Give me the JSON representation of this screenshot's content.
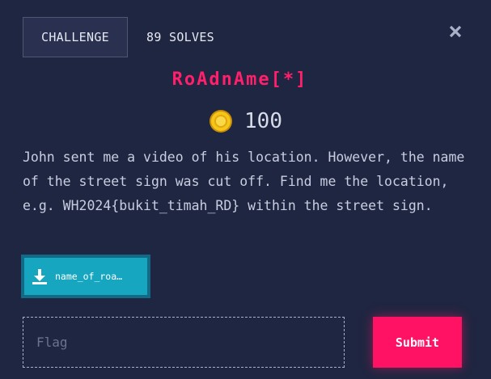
{
  "header": {
    "challenge_tab": "CHALLENGE",
    "solves_tab": "89 SOLVES"
  },
  "challenge": {
    "title": "RoAdnAme[*]",
    "points": "100",
    "description": "John sent me a video of his location. However, the name of the street sign was cut off. Find me the location, e.g. WH2024{bukit_timah_RD} within the street sign.",
    "file_label": "name_of_roa…"
  },
  "form": {
    "flag_placeholder": "Flag",
    "flag_value": "",
    "submit_label": "Submit"
  },
  "icons": {
    "close": "close-icon",
    "coin": "coin-icon",
    "download": "download-icon"
  },
  "colors": {
    "background": "#1f2641",
    "accent_pink": "#ff1163",
    "download_teal": "#17a6c0",
    "coin_gold": "#f5c518"
  }
}
